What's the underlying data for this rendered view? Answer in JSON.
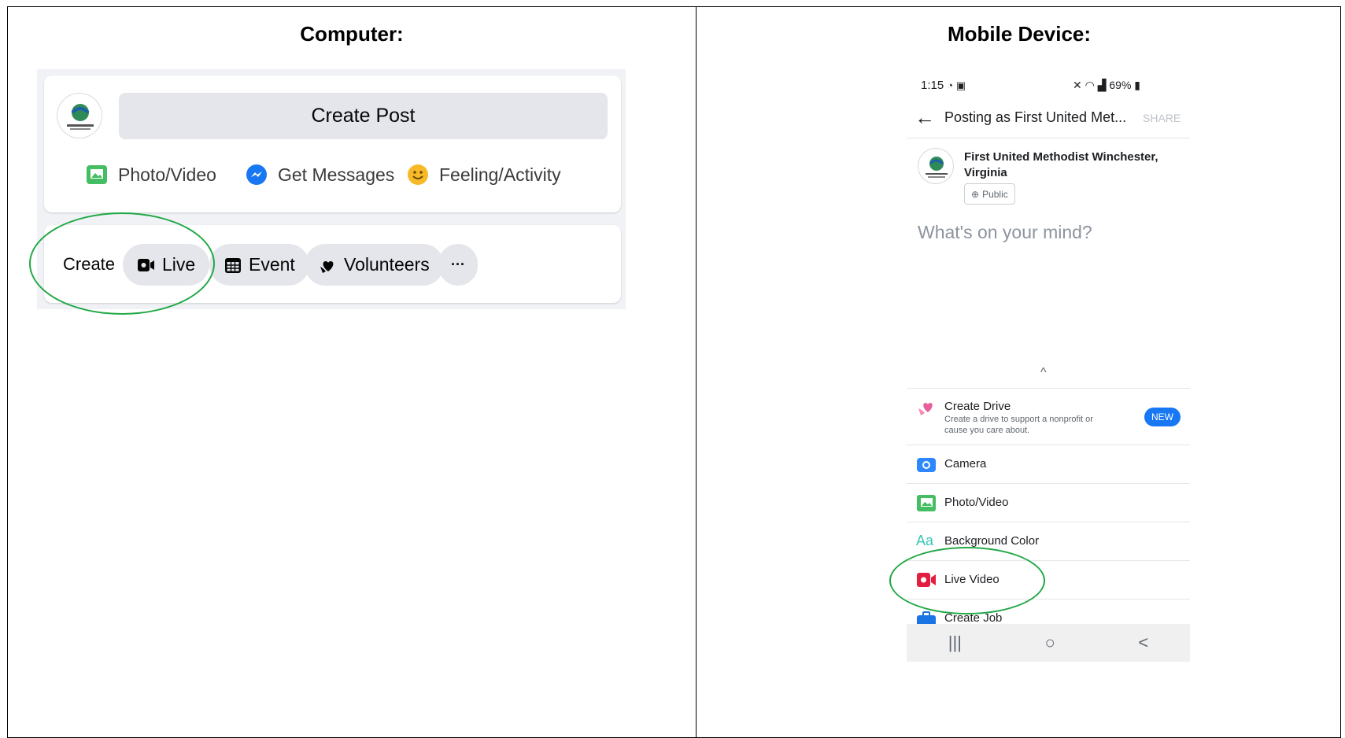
{
  "panels": {
    "computer_heading": "Computer:",
    "mobile_heading": "Mobile Device:"
  },
  "desktop": {
    "create_post": "Create Post",
    "actions": [
      {
        "label": "Photo/Video",
        "icon": "photo-video-icon",
        "color": "#45bd62"
      },
      {
        "label": "Get Messages",
        "icon": "messenger-icon",
        "color": "#1877f2"
      },
      {
        "label": "Feeling/Activity",
        "icon": "smiley-icon",
        "color": "#f7b928"
      }
    ],
    "create_label": "Create",
    "create_buttons": [
      {
        "label": "Live",
        "icon": "live-video-icon"
      },
      {
        "label": "Event",
        "icon": "calendar-icon"
      },
      {
        "label": "Volunteers",
        "icon": "volunteers-icon"
      },
      {
        "label": "···",
        "icon": "more-icon"
      }
    ],
    "highlight_color": "#21a846"
  },
  "mobile": {
    "status_time": "1:15",
    "status_right": "69%",
    "header_title": "Posting as First United Met...",
    "share_label": "SHARE",
    "page_name": "First United Methodist Winchester, Virginia",
    "audience": "Public",
    "placeholder": "What's on your mind?",
    "options": [
      {
        "label": "Create Drive",
        "sub": "Create a drive to support a nonprofit or cause you care about.",
        "badge": "NEW",
        "icon": "heart-hand-icon"
      },
      {
        "label": "Camera",
        "icon": "camera-icon"
      },
      {
        "label": "Photo/Video",
        "icon": "photo-video-icon"
      },
      {
        "label": "Background Color",
        "icon": "text-aa-icon"
      },
      {
        "label": "Live Video",
        "icon": "live-video-icon"
      },
      {
        "label": "Create Job",
        "icon": "briefcase-icon"
      }
    ],
    "nav": [
      "|||",
      "○",
      "<"
    ]
  }
}
